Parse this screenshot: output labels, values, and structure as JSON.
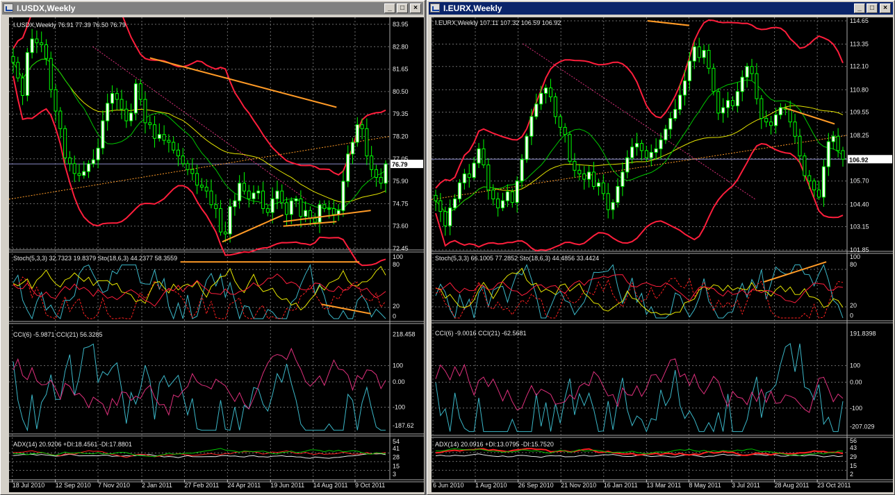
{
  "colors": {
    "panel": "#000000",
    "grid": "#6e6e6e",
    "bull": "#ffffff",
    "candle_edge": "#00ff00",
    "bear": "#000000",
    "band": "#ff1e3c",
    "ma_green": "#00c800",
    "ma_yellow": "#e6e600",
    "trend": "#ff9a26",
    "cyan": "#3bb7c8",
    "magenta": "#e0307d",
    "red": "#ff2020",
    "white": "#e8e8e8",
    "price_line": "#8c8cc8"
  },
  "icons": {
    "window": "chart-window-icon",
    "minimize": "minimize-icon",
    "maximize": "maximize-icon",
    "close": "close-icon"
  },
  "buttons": {
    "minimize": "_",
    "maximize": "□",
    "close": "×"
  },
  "windows": [
    {
      "title": "I.USDX,Weekly",
      "main_label": "I.USDX,Weekly  76.91 77.39 76.50 76.79",
      "price_ticks": [
        "83.95",
        "82.80",
        "81.65",
        "80.50",
        "79.35",
        "78.20",
        "77.05",
        "75.90",
        "74.75",
        "73.60",
        "72.45"
      ],
      "current_price": "76.79",
      "stoch_label": "Stoch(5,3,3) 32.7323 19.8379  Sto(18,6,3) 44.2377 58.3559",
      "stoch_ticks": [
        "100",
        "80",
        "20",
        "0"
      ],
      "cci_label": "CCI(6) -5.9871  CCI(21) 56.3285",
      "cci_ticks": [
        "218.458",
        "100",
        "0.00",
        "-100",
        "-187.62"
      ],
      "adx_label": "ADX(14) 20.9206  +DI:18.4561  -DI:17.8801",
      "adx_ticks": [
        "54",
        "41",
        "28",
        "15",
        "3"
      ],
      "dates": [
        "18 Jul 2010",
        "12 Sep 2010",
        "7 Nov 2010",
        "2 Jan 2011",
        "27 Feb 2011",
        "24 Apr 2011",
        "19 Jun 2011",
        "14 Aug 2011",
        "9 Oct 2011"
      ],
      "seed": 11,
      "closes": [
        82.0,
        81.2,
        80.3,
        82.5,
        83.2,
        83.0,
        82.9,
        82.2,
        80.6,
        79.5,
        78.6,
        77.1,
        76.8,
        76.3,
        76.2,
        76.4,
        76.8,
        77.0,
        77.6,
        79.0,
        79.9,
        80.4,
        80.1,
        79.6,
        79.0,
        79.4,
        80.9,
        80.1,
        78.9,
        78.8,
        78.1,
        78.3,
        78.0,
        77.9,
        77.5,
        77.2,
        76.8,
        76.5,
        76.3,
        75.7,
        75.6,
        75.4,
        74.7,
        74.5,
        73.3,
        73.2,
        74.6,
        74.9,
        75.8,
        75.4,
        75.0,
        75.3,
        75.4,
        74.5,
        74.3,
        75.0,
        75.4,
        74.8,
        74.2,
        74.9,
        75.0,
        74.1,
        74.4,
        74.0,
        73.8,
        74.7,
        74.5,
        74.5,
        74.2,
        74.4,
        75.9,
        77.3,
        77.9,
        78.8,
        78.6,
        77.2,
        76.5,
        76.1,
        75.8,
        76.79
      ]
    },
    {
      "title": "I.EURX,Weekly",
      "main_label": "I.EURX,Weekly  107.11 107.32 106.59 106.92",
      "price_ticks": [
        "114.65",
        "113.35",
        "112.10",
        "110.80",
        "109.55",
        "108.25",
        "106.95",
        "105.70",
        "104.40",
        "103.15",
        "101.85"
      ],
      "current_price": "106.92",
      "stoch_label": "Stoch(5,3,3) 66.1005 77.2852  Sto(18,6,3) 44.4856 33.4424",
      "stoch_ticks": [
        "100",
        "80",
        "20",
        "0"
      ],
      "cci_label": "CCI(6) -9.0016  CCI(21) -62.5681",
      "cci_ticks": [
        "191.8398",
        "100",
        "0.00",
        "-100",
        "-207.029"
      ],
      "adx_label": "ADX(14) 20.0916  +DI:13.0795  -DI:15.7520",
      "adx_ticks": [
        "56",
        "43",
        "29",
        "15",
        "2"
      ],
      "dates": [
        "6 Jun 2010",
        "1 Aug 2010",
        "26 Sep 2010",
        "21 Nov 2010",
        "16 Jan 2011",
        "13 Mar 2011",
        "8 May 2011",
        "3 Jul 2011",
        "28 Aug 2011",
        "23 Oct 2011"
      ],
      "seed": 29,
      "closes": [
        104.6,
        104.0,
        103.2,
        104.2,
        104.7,
        105.6,
        106.1,
        105.9,
        106.7,
        107.5,
        106.6,
        105.2,
        104.7,
        104.2,
        104.6,
        105.1,
        104.5,
        105.7,
        106.9,
        108.2,
        109.3,
        110.0,
        110.6,
        110.9,
        110.4,
        109.3,
        108.7,
        108.3,
        106.8,
        106.3,
        106.1,
        105.8,
        106.2,
        105.4,
        105.6,
        105.0,
        104.1,
        104.5,
        105.4,
        106.2,
        107.0,
        107.6,
        107.8,
        107.4,
        107.0,
        107.3,
        107.5,
        108.0,
        108.6,
        109.2,
        109.7,
        110.5,
        111.3,
        112.4,
        113.2,
        112.6,
        113.0,
        112.0,
        110.7,
        109.5,
        109.8,
        110.2,
        109.9,
        110.7,
        111.5,
        112.1,
        111.7,
        110.3,
        109.2,
        109.0,
        108.8,
        109.4,
        109.8,
        109.7,
        109.0,
        108.2,
        107.1,
        106.0,
        105.7,
        105.2,
        104.8,
        106.5,
        107.9,
        108.2,
        107.4,
        106.92
      ]
    }
  ]
}
